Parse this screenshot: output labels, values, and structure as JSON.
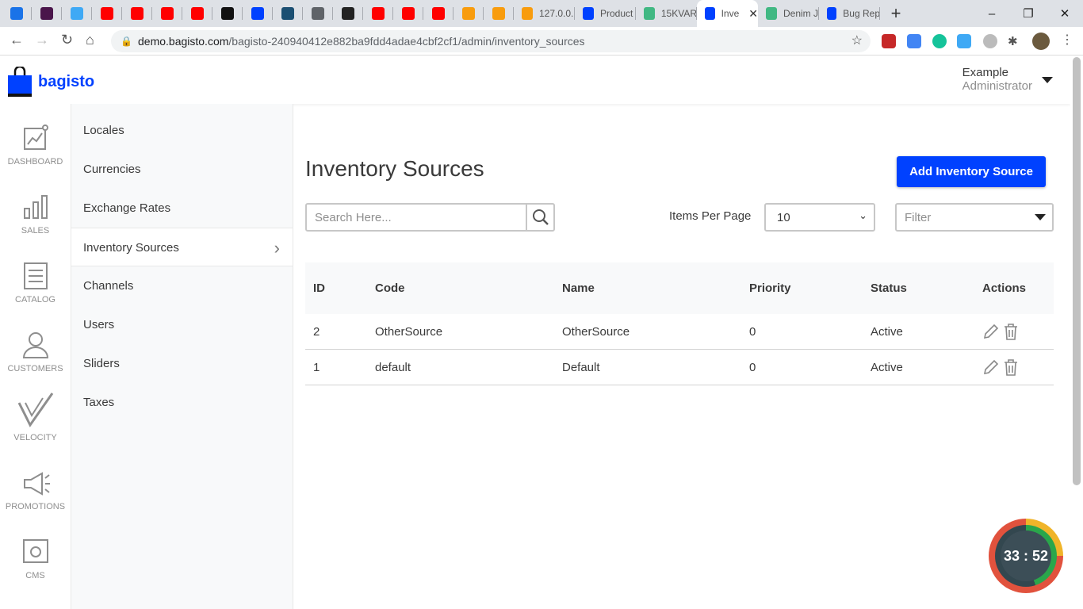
{
  "browser": {
    "pinned_tabs": [
      {
        "icon": "check-icon",
        "color": "#1a73e8"
      },
      {
        "icon": "slack-icon",
        "color": "#4a154b"
      },
      {
        "icon": "zapier-icon",
        "color": "#3fa9f5"
      },
      {
        "icon": "youtube-icon",
        "color": "#ff0000"
      },
      {
        "icon": "youtube-icon",
        "color": "#ff0000"
      },
      {
        "icon": "youtube-icon",
        "color": "#ff0000"
      },
      {
        "icon": "youtube-icon",
        "color": "#ff0000"
      },
      {
        "icon": "hackerrank-icon",
        "color": "#111111"
      },
      {
        "icon": "bagisto-icon",
        "color": "#0041ff"
      },
      {
        "icon": "pfs-icon",
        "color": "#1b4f72"
      },
      {
        "icon": "globe-icon",
        "color": "#5f6368"
      },
      {
        "icon": "github-icon",
        "color": "#222222"
      },
      {
        "icon": "youtube-icon",
        "color": "#ff0000"
      },
      {
        "icon": "youtube-icon",
        "color": "#ff0000"
      },
      {
        "icon": "youtube-icon",
        "color": "#ff0000"
      },
      {
        "icon": "phpmyadmin-icon",
        "color": "#f89c0e"
      },
      {
        "icon": "phpmyadmin-icon",
        "color": "#f89c0e"
      }
    ],
    "tabs": [
      {
        "title": "127.0.0.",
        "icon": "phpmyadmin-icon"
      },
      {
        "title": "Product",
        "icon": "bagisto-icon"
      },
      {
        "title": "15KVAR",
        "icon": "vue-icon"
      },
      {
        "title": "Inve",
        "icon": "bagisto-icon",
        "active": true
      },
      {
        "title": "Denim J",
        "icon": "vue-icon"
      },
      {
        "title": "Bug Rep",
        "icon": "bagisto-icon"
      }
    ],
    "url_host": "demo.bagisto.com",
    "url_path": "/bagisto-240940412e882ba9fdd4adae4cbf2cf1/admin/inventory_sources"
  },
  "header": {
    "logo": "bagisto",
    "user_name": "Example",
    "user_role": "Administrator"
  },
  "rail": [
    {
      "label": "DASHBOARD",
      "icon": "dashboard-icon"
    },
    {
      "label": "SALES",
      "icon": "bar-chart-icon"
    },
    {
      "label": "CATALOG",
      "icon": "catalog-icon"
    },
    {
      "label": "CUSTOMERS",
      "icon": "user-icon"
    },
    {
      "label": "VELOCITY",
      "icon": "velocity-icon"
    },
    {
      "label": "PROMOTIONS",
      "icon": "megaphone-icon"
    },
    {
      "label": "CMS",
      "icon": "cms-icon"
    }
  ],
  "submenu": [
    "Locales",
    "Currencies",
    "Exchange Rates",
    "Inventory Sources",
    "Channels",
    "Users",
    "Sliders",
    "Taxes"
  ],
  "main": {
    "title": "Inventory Sources",
    "add_button": "Add Inventory Source",
    "search_placeholder": "Search Here...",
    "items_per_page_label": "Items Per Page",
    "items_per_page": "10",
    "filter_placeholder": "Filter",
    "columns": [
      "ID",
      "Code",
      "Name",
      "Priority",
      "Status",
      "Actions"
    ],
    "rows": [
      {
        "id": "2",
        "code": "OtherSource",
        "name": "OtherSource",
        "priority": "0",
        "status": "Active"
      },
      {
        "id": "1",
        "code": "default",
        "name": "Default",
        "priority": "0",
        "status": "Active"
      }
    ]
  },
  "timer": "33 : 52"
}
